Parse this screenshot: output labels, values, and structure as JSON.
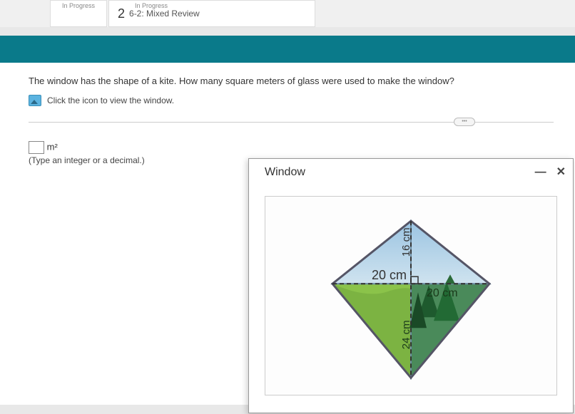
{
  "tabs": {
    "tab1_status": "In Progress",
    "tab2_status": "In Progress",
    "tab2_num": "2",
    "tab2_title": "6-2: Mixed Review"
  },
  "question": "The window has the shape of a kite. How many square meters of glass were used to make the window?",
  "icon_prompt": "Click the icon to view the window.",
  "answer": {
    "unit": "m²",
    "hint": "(Type an integer or a decimal.)"
  },
  "popup": {
    "title": "Window",
    "minimize": "—",
    "close": "✕"
  },
  "chart_data": {
    "type": "diagram",
    "shape": "kite",
    "labels": {
      "left_half_diagonal": "20 cm",
      "right_half_diagonal": "20 cm",
      "top_half_diagonal": "16 cm",
      "bottom_half_diagonal": "24 cm"
    },
    "diagonal_horizontal_total_cm": 40,
    "diagonal_vertical_total_cm": 40,
    "right_angle_marker": true
  }
}
